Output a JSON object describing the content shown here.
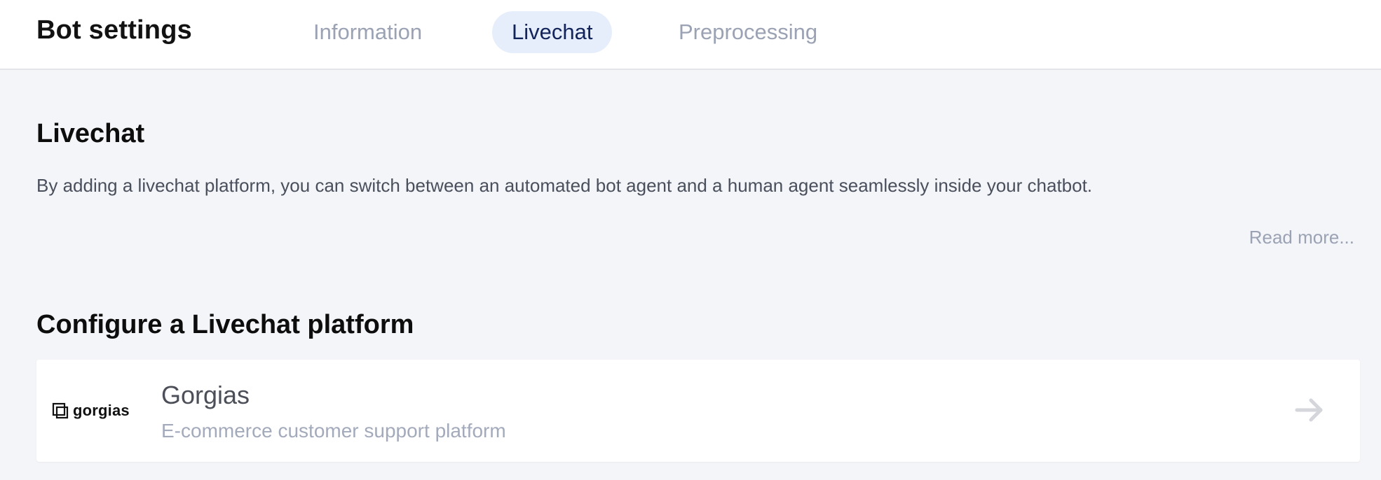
{
  "header": {
    "title": "Bot settings",
    "tabs": [
      {
        "label": "Information",
        "active": false
      },
      {
        "label": "Livechat",
        "active": true
      },
      {
        "label": "Preprocessing",
        "active": false
      }
    ]
  },
  "livechat": {
    "heading": "Livechat",
    "description": "By adding a livechat platform, you can switch between an automated bot agent and a human agent seamlessly inside your chatbot.",
    "read_more": "Read more..."
  },
  "configure": {
    "heading": "Configure a Livechat platform",
    "platforms": [
      {
        "logo_text": "gorgias",
        "logo_icon": "gorgias-logo-icon",
        "name": "Gorgias",
        "description": "E-commerce customer support platform",
        "action_icon": "arrow-right-icon"
      }
    ]
  },
  "colors": {
    "background": "#f4f5f9",
    "active_tab_bg": "#e6eefc",
    "active_tab_text": "#13245a",
    "muted_text": "#9aa2b4"
  }
}
